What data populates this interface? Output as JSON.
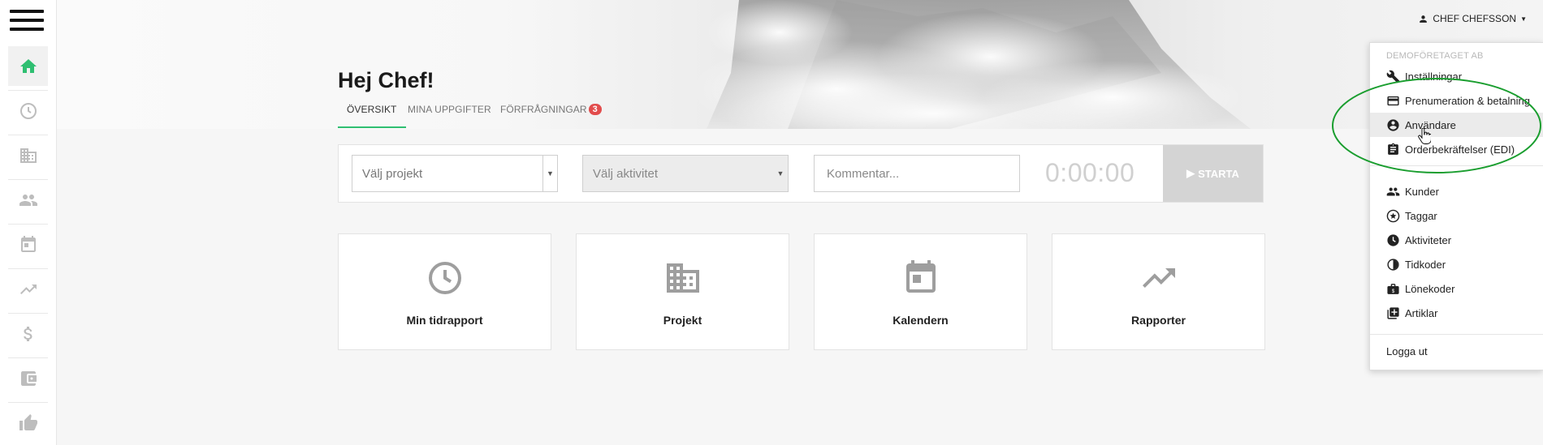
{
  "sidebar": {
    "items": [
      {
        "icon": "home-icon",
        "active": true
      },
      {
        "icon": "clock-icon"
      },
      {
        "icon": "building-icon"
      },
      {
        "icon": "people-icon"
      },
      {
        "icon": "calendar-icon"
      },
      {
        "icon": "trending-up-icon"
      },
      {
        "icon": "dollar-icon"
      },
      {
        "icon": "wallet-icon"
      },
      {
        "icon": "thumbs-up-icon"
      }
    ]
  },
  "header": {
    "greeting": "Hej Chef!",
    "tabs": [
      {
        "label": "ÖVERSIKT",
        "active": true
      },
      {
        "label": "MINA UPPGIFTER"
      },
      {
        "label": "FÖRFRÅGNINGAR",
        "badge": "3"
      }
    ],
    "user_name": "CHEF CHEFSSON"
  },
  "timer": {
    "project_placeholder": "Välj projekt",
    "activity_placeholder": "Välj aktivitet",
    "comment_placeholder": "Kommentar...",
    "time": "0:00:00",
    "start_label": "STARTA"
  },
  "cards": [
    {
      "label": "Min tidrapport",
      "icon": "clock-icon"
    },
    {
      "label": "Projekt",
      "icon": "building-icon"
    },
    {
      "label": "Kalendern",
      "icon": "calendar-icon"
    },
    {
      "label": "Rapporter",
      "icon": "trending-up-icon"
    }
  ],
  "dropdown": {
    "company_header": "DEMOFÖRETAGET AB",
    "company_items": [
      {
        "label": "Inställningar",
        "icon": "wrench-icon"
      },
      {
        "label": "Prenumeration & betalning",
        "icon": "credit-card-icon"
      },
      {
        "label": "Användare",
        "icon": "account-circle-icon"
      },
      {
        "label": "Orderbekräftelser (EDI)",
        "icon": "clipboard-icon"
      }
    ],
    "register_items": [
      {
        "label": "Kunder",
        "icon": "people-icon"
      },
      {
        "label": "Taggar",
        "icon": "star-circle-icon"
      },
      {
        "label": "Aktiviteter",
        "icon": "clock-icon"
      },
      {
        "label": "Tidkoder",
        "icon": "half-circle-icon"
      },
      {
        "label": "Lönekoder",
        "icon": "bag-dollar-icon"
      },
      {
        "label": "Artiklar",
        "icon": "add-box-icon"
      }
    ],
    "logout_label": "Logga ut"
  },
  "colors": {
    "accent": "#2fbf71",
    "badge": "#e24c4c",
    "annotation": "#1a9e2f"
  }
}
